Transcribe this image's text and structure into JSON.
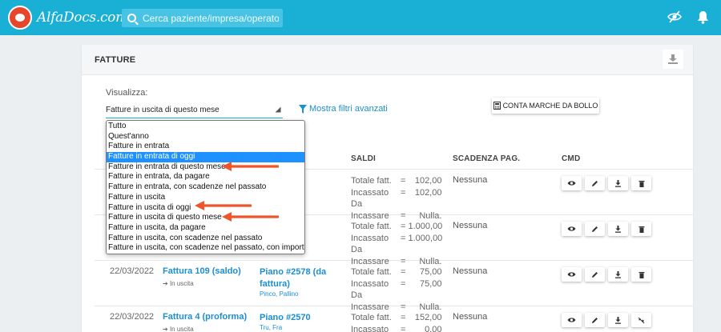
{
  "header": {
    "app_name": "AlfaDocs.com",
    "search_placeholder": "Cerca paziente/impresa/operatore",
    "icons": [
      "eye-slash-icon",
      "bell-icon"
    ]
  },
  "card": {
    "title": "FATTURE",
    "visualizza_label": "Visualizza:",
    "selected_view": "Fatture in uscita di questo mese",
    "filters_link": "Mostra filtri avanzati",
    "stamps_button": "CONTA MARCHE DA BOLLO"
  },
  "dropdown": {
    "options": [
      "Tutto",
      "Quest'anno",
      "Fatture in entrata",
      "Fatture in entrata di oggi",
      "Fatture in entrata di questo mese",
      "Fatture in entrata, da pagare",
      "Fatture in entrata, con scadenze nel passato",
      "Fatture in uscita",
      "Fatture in uscita di oggi",
      "Fatture in uscita di questo mese",
      "Fatture in uscita, da pagare",
      "Fatture in uscita, con scadenze nel passato",
      "Fatture in uscita, con scadenze nel passato, con importo ente"
    ],
    "highlighted_index": 3,
    "accent": "#1e90ff"
  },
  "table": {
    "headers": {
      "saldi": "SALDI",
      "scadenza": "SCADENZA PAG.",
      "cmd": "CMD"
    },
    "labels": {
      "totale": "Totale fatt.",
      "incassato": "Incassato",
      "da_incassare": "Da Incassare"
    },
    "rows": [
      {
        "totale": "102,00",
        "incassato": "102,00",
        "da_incassare": "Nulla.",
        "scadenza": "Nessuna"
      },
      {
        "totale": "1.000,00",
        "incassato": "1.000,00",
        "da_incassare": "Nulla.",
        "scadenza": "Nessuna"
      },
      {
        "date": "22/03/2022",
        "invoice": "Fattura 109 (saldo)",
        "direction": "In uscita",
        "plan": "Piano #2578 (da fattura)",
        "patient": "Pinco, Pallino",
        "totale": "75,00",
        "incassato": "75,00",
        "da_incassare": "Nulla.",
        "scadenza": "Nessuna"
      },
      {
        "date": "22/03/2022",
        "invoice": "Fattura 4 (proforma)",
        "direction": "In uscita",
        "plan": "Piano #2570",
        "patient": "Tru, Fra",
        "totale": "152,00",
        "incassato": "0,00",
        "scadenza": "Nessuna"
      }
    ]
  },
  "colors": {
    "primary": "#1ab0d6",
    "link": "#1a8fd1",
    "annotation_arrow": "#f0552a"
  }
}
